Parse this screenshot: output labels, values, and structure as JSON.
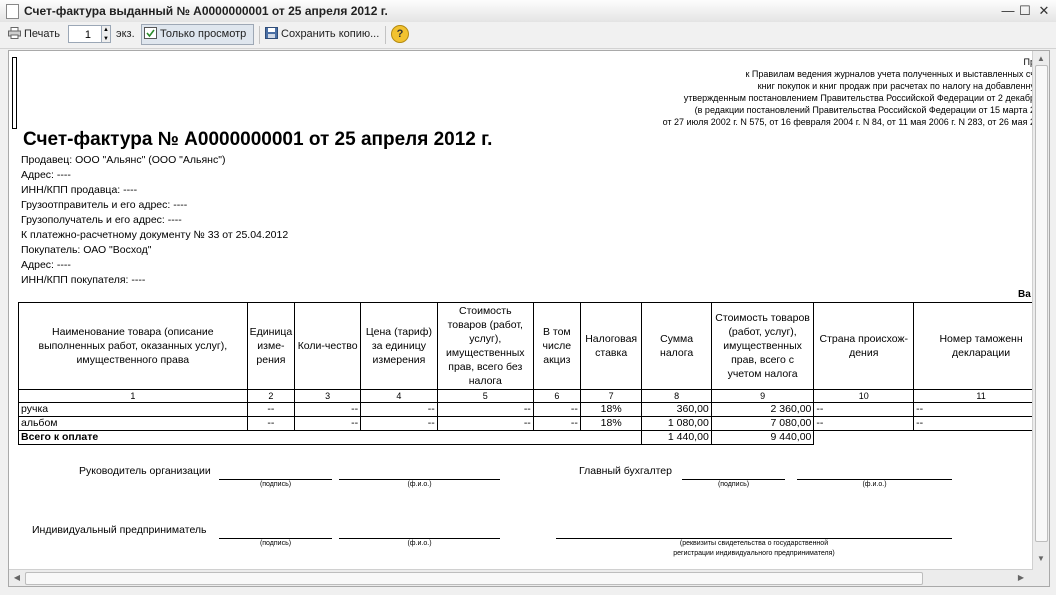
{
  "window": {
    "title": "Счет-фактура выданный № А0000000001 от 25 апреля 2012 г.",
    "minimize_glyph": "—",
    "maximize_glyph": "☐",
    "close_glyph": "✕"
  },
  "toolbar": {
    "print_label": "Печать",
    "copies_value": "1",
    "copies_suffix": "экз.",
    "view_only_label": "Только просмотр",
    "save_copy_label": "Сохранить копию...",
    "help_glyph": "?"
  },
  "document": {
    "notes": [
      "Пр",
      "к Правилам ведения журналов учета полученных и выставленных сч",
      "книг покупок и книг продаж при расчетах по налогу на добавленну",
      "утвержденным постановлением Правительства Российской Федерации от 2 декабр",
      "(в редакции постановлений Правительства Российской Федерации от 15 марта 2",
      "от 27 июля 2002 г. N 575, от 16 февраля 2004 г. N 84, от 11 мая 2006 г. N 283, от 26 мая 2"
    ],
    "title": "Счет-фактура № А0000000001 от 25 апреля 2012 г.",
    "info": [
      "Продавец: ООО \"Альянс\" (ООО \"Альянс\")",
      "Адрес: ----",
      "ИНН/КПП продавца: ----",
      "Грузоотправитель и его адрес: ----",
      "Грузополучатель и его адрес: ----",
      "К платежно-расчетному документу № 33 от 25.04.2012",
      "Покупатель: ОАО \"Восход\"",
      "Адрес: ----",
      "ИНН/КПП покупателя: ----"
    ],
    "currency_fragment": "Ва"
  },
  "table": {
    "headers": [
      "Наименование товара (описание выполненных работ, оказанных услуг), имущественного права",
      "Единица изме-рения",
      "Коли-чество",
      "Цена (тариф) за единицу измерения",
      "Стоимость товаров (работ, услуг), имущественных прав, всего без налога",
      "В том числе акциз",
      "Налоговая ставка",
      "Сумма налога",
      "Стоимость товаров (работ, услуг), имущественных прав, всего с учетом налога",
      "Страна происхож-дения",
      "Номер таможенн декларации"
    ],
    "numbers": [
      "1",
      "2",
      "3",
      "4",
      "5",
      "6",
      "7",
      "8",
      "9",
      "10",
      "11"
    ],
    "rows": [
      [
        "ручка",
        "--",
        "--",
        "--",
        "--",
        "--",
        "18%",
        "360,00",
        "2 360,00",
        "--",
        "--"
      ],
      [
        "альбом",
        "--",
        "--",
        "--",
        "--",
        "--",
        "18%",
        "1 080,00",
        "7 080,00",
        "--",
        "--"
      ]
    ],
    "total_label": "Всего к оплате",
    "total_tax": "1 440,00",
    "total_sum": "9 440,00"
  },
  "signatures": {
    "head_label": "Руководитель организации",
    "accountant_label": "Главный бухгалтер",
    "entrepreneur_label": "Индивидуальный предприниматель",
    "signature_caption": "(подпись)",
    "name_caption": "(ф.и.о.)",
    "requisites_caption_1": "(реквизиты свидетельства о государственной",
    "requisites_caption_2": "регистрации индивидуального предпринимателя)"
  }
}
